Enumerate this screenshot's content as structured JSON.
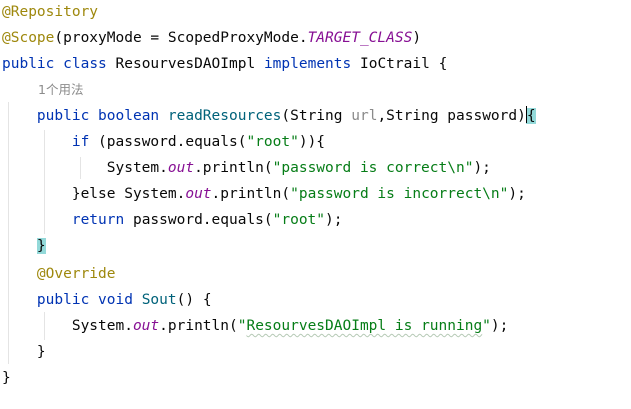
{
  "code": {
    "annotation_repository": "@Repository",
    "annotation_scope": "@Scope",
    "scope_args_open": "(proxyMode = ScopedProxyMode.",
    "scope_constant": "TARGET_CLASS",
    "scope_args_close": ")",
    "kw_public": "public",
    "kw_class": "class",
    "class_name": "ResourvesDAOImpl",
    "kw_implements": "implements",
    "interface_name": "IoCtrail",
    "brace_open": "{",
    "usage_hint": "1个用法",
    "kw_boolean": "boolean",
    "method_read": "readResources",
    "param_string_type": "(String ",
    "param_url": "url",
    "param_rest": ",String password)",
    "kw_if": "if",
    "if_condition": " (password.equals(",
    "str_root": "\"root\"",
    "if_close": ")){",
    "system_prefix": "System.",
    "out_field": "out",
    "println_open": ".println(",
    "str_correct": "\"password is correct\\n\"",
    "call_close": ");",
    "else_part": "}else System.",
    "str_incorrect": "\"password is incorrect\\n\"",
    "kw_return": "return",
    "return_expr": " password.equals(",
    "brace_close": "}",
    "annotation_override": "@Override",
    "kw_void": "void",
    "method_sout": "Sout",
    "sout_sig": "() {",
    "str_running_quote_open": "\"",
    "str_running_body": "ResourvesDAOImpl is running",
    "str_running_quote_close": "\""
  },
  "colors": {
    "annotation": "#9e880d",
    "keyword": "#0033b3",
    "method": "#00627a",
    "string": "#067d17",
    "static_field": "#871094",
    "unused_param": "#8a8a8a",
    "brace_match_highlight": "#93d9d9"
  }
}
